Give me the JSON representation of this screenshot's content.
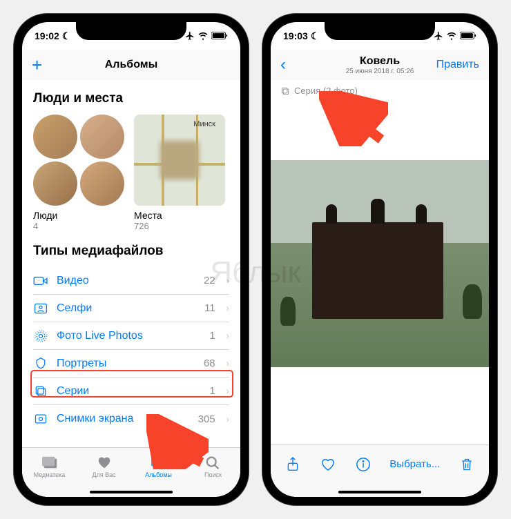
{
  "watermark": "Яблык",
  "left": {
    "status": {
      "time": "19:02",
      "moon": "☾"
    },
    "nav": {
      "title": "Альбомы",
      "plus": "+"
    },
    "section_people": "Люди и места",
    "people": {
      "label": "Люди",
      "count": "4"
    },
    "places": {
      "label": "Места",
      "count": "726",
      "city": "Минск"
    },
    "section_media": "Типы медиафайлов",
    "media": [
      {
        "icon": "video",
        "label": "Видео",
        "count": "22"
      },
      {
        "icon": "selfie",
        "label": "Селфи",
        "count": "11"
      },
      {
        "icon": "live",
        "label": "Фото Live Photos",
        "count": "1"
      },
      {
        "icon": "portrait",
        "label": "Портреты",
        "count": "68"
      },
      {
        "icon": "burst",
        "label": "Серии",
        "count": "1"
      },
      {
        "icon": "screenshot",
        "label": "Снимки экрана",
        "count": "305"
      }
    ],
    "tabs": [
      {
        "label": "Медиатека"
      },
      {
        "label": "Для Вас"
      },
      {
        "label": "Альбомы"
      },
      {
        "label": "Поиск"
      }
    ]
  },
  "right": {
    "status": {
      "time": "19:03",
      "moon": "☾"
    },
    "nav": {
      "title": "Ковель",
      "subtitle": "25 июня 2018 г.  05:26",
      "edit": "Править"
    },
    "burst": "Серия (2 фото)",
    "toolbar": {
      "select": "Выбрать..."
    }
  }
}
